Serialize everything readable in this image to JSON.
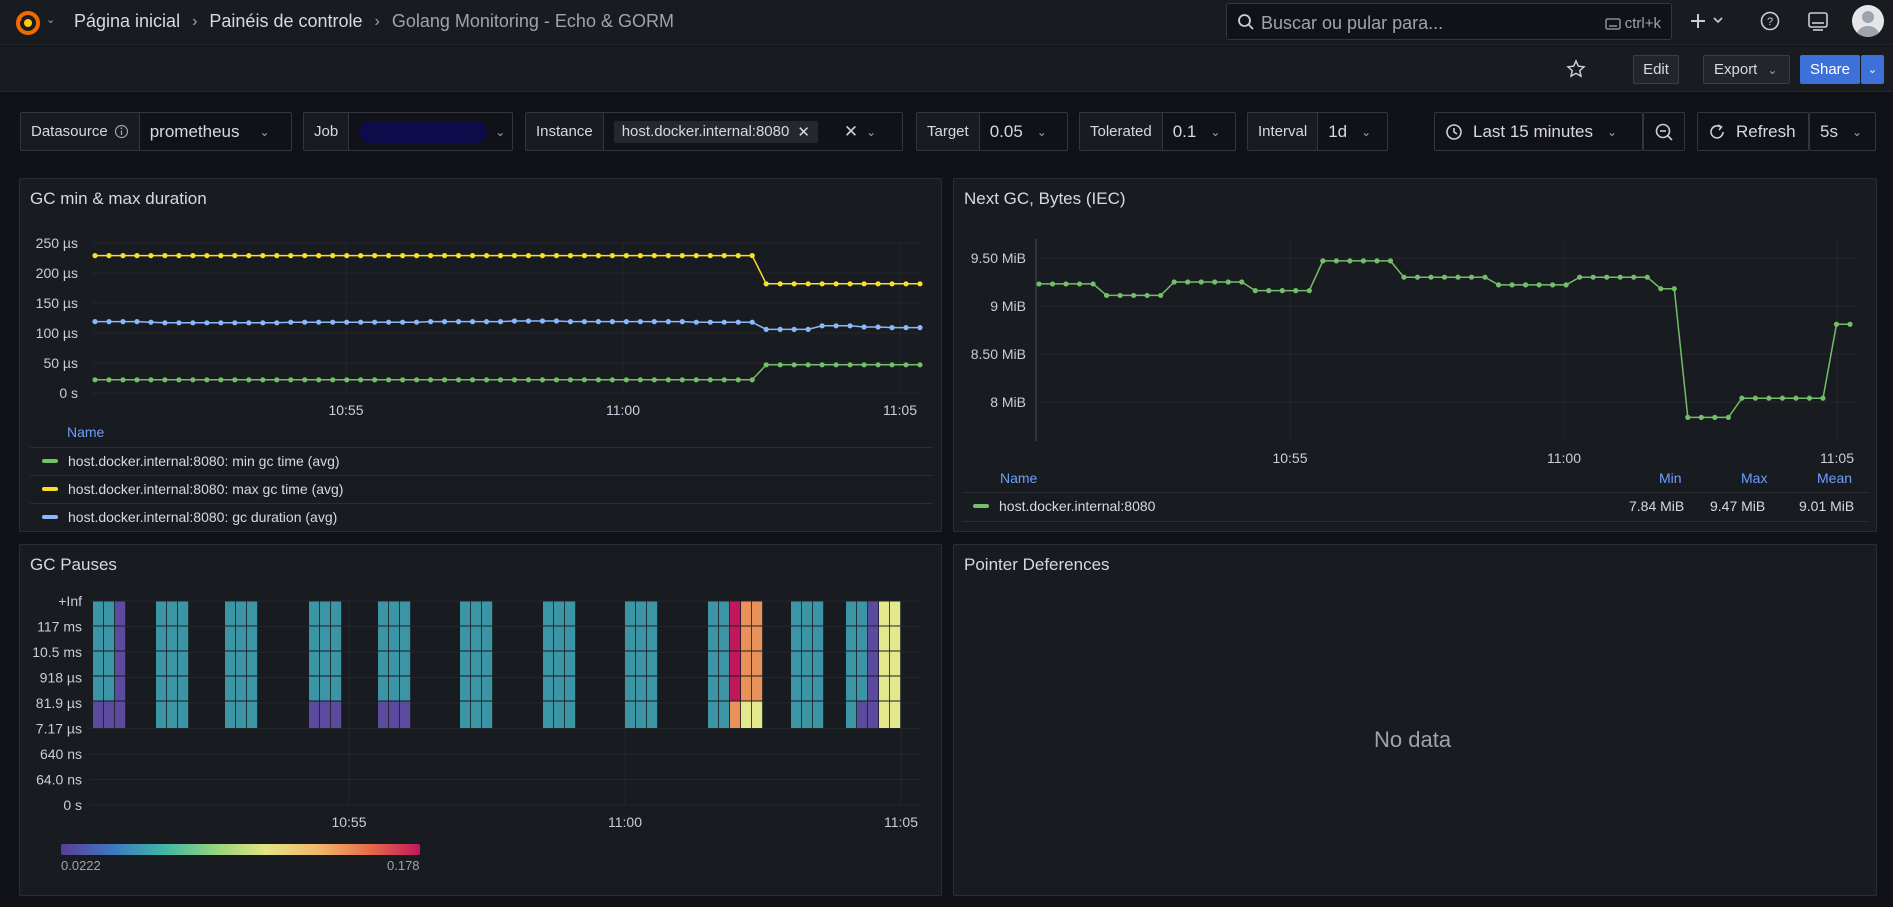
{
  "topbar": {
    "breadcrumbs": [
      "Página inicial",
      "Painéis de controle",
      "Golang Monitoring - Echo & GORM"
    ],
    "search_placeholder": "Buscar ou pular para...",
    "search_shortcut": "ctrl+k"
  },
  "actions": {
    "edit": "Edit",
    "export": "Export",
    "share": "Share"
  },
  "variables": [
    {
      "label": "Datasource",
      "value": "prometheus"
    },
    {
      "label": "Job",
      "value": ""
    },
    {
      "label": "Instance",
      "value": "host.docker.internal:8080"
    },
    {
      "label": "Target",
      "value": "0.05"
    },
    {
      "label": "Tolerated",
      "value": "0.1"
    },
    {
      "label": "Interval",
      "value": "1d"
    }
  ],
  "timepicker": {
    "range": "Last 15 minutes",
    "refresh_label": "Refresh",
    "refresh_interval": "5s"
  },
  "colors": {
    "green": "#73bf69",
    "yellow": "#fade2a",
    "blue": "#8ab8ff",
    "accent": "#3d71d9"
  },
  "panels": {
    "gc_duration": {
      "title": "GC min & max duration",
      "legend_header": "Name",
      "legend": [
        "host.docker.internal:8080: min gc time (avg)",
        "host.docker.internal:8080: max gc time (avg)",
        "host.docker.internal:8080: gc duration (avg)"
      ]
    },
    "next_gc": {
      "title": "Next GC, Bytes (IEC)",
      "legend_header": {
        "name": "Name",
        "min": "Min",
        "max": "Max",
        "mean": "Mean"
      },
      "legend": [
        {
          "name": "host.docker.internal:8080",
          "min": "7.84 MiB",
          "max": "9.47 MiB",
          "mean": "9.01 MiB"
        }
      ]
    },
    "gc_pauses": {
      "title": "GC Pauses",
      "scale_min": "0.0222",
      "scale_max": "0.178"
    },
    "pointer": {
      "title": "Pointer Deferences",
      "nodata": "No data"
    }
  },
  "chart_data": [
    {
      "type": "line",
      "title": "GC min & max duration",
      "ylabels": [
        "250 µs",
        "200 µs",
        "150 µs",
        "100 µs",
        "50 µs",
        "0 s"
      ],
      "ylim": [
        0,
        250
      ],
      "xlabels": [
        "10:55",
        "11:00",
        "11:05"
      ],
      "n": 60,
      "series": [
        {
          "name": "host.docker.internal:8080: min gc time (avg)",
          "color": "#73bf69",
          "segments": [
            [
              0,
              47,
              22
            ],
            [
              48,
              59,
              47
            ]
          ]
        },
        {
          "name": "host.docker.internal:8080: max gc time (avg)",
          "color": "#fade2a",
          "segments": [
            [
              0,
              47,
              229
            ],
            [
              48,
              59,
              182
            ]
          ]
        },
        {
          "name": "host.docker.internal:8080: gc duration (avg)",
          "color": "#8ab8ff",
          "values": [
            119,
            119,
            119,
            119,
            118,
            117,
            117,
            117,
            117,
            117,
            117,
            117,
            117,
            117,
            118,
            118,
            118,
            118,
            118,
            118,
            118,
            118,
            118,
            118,
            119,
            119,
            119,
            119,
            119,
            119,
            120,
            120,
            120,
            120,
            119,
            119,
            119,
            119,
            119,
            119,
            119,
            119,
            119,
            118,
            118,
            118,
            118,
            118,
            106,
            106,
            106,
            106,
            112,
            112,
            112,
            110,
            110,
            109,
            109,
            109
          ]
        }
      ]
    },
    {
      "type": "line",
      "title": "Next GC, Bytes (IEC)",
      "ylabels": [
        "9.50 MiB",
        "9 MiB",
        "8.50 MiB",
        "8 MiB"
      ],
      "ylim": [
        7.7,
        9.6
      ],
      "xlabels": [
        "10:55",
        "11:00",
        "11:05"
      ],
      "series": [
        {
          "name": "host.docker.internal:8080",
          "color": "#73bf69",
          "values": [
            9.23,
            9.23,
            9.23,
            9.23,
            9.23,
            9.11,
            9.11,
            9.11,
            9.11,
            9.11,
            9.25,
            9.25,
            9.25,
            9.25,
            9.25,
            9.25,
            9.16,
            9.16,
            9.16,
            9.16,
            9.16,
            9.47,
            9.47,
            9.47,
            9.47,
            9.47,
            9.47,
            9.3,
            9.3,
            9.3,
            9.3,
            9.3,
            9.3,
            9.3,
            9.22,
            9.22,
            9.22,
            9.22,
            9.22,
            9.22,
            9.3,
            9.3,
            9.3,
            9.3,
            9.3,
            9.3,
            9.18,
            9.18,
            7.84,
            7.84,
            7.84,
            7.84,
            8.04,
            8.04,
            8.04,
            8.04,
            8.04,
            8.04,
            8.04,
            8.81,
            8.81
          ]
        }
      ]
    },
    {
      "type": "heatmap",
      "title": "GC Pauses",
      "ylabels": [
        "+Inf",
        "117 ms",
        "10.5 ms",
        "918 µs",
        "81.9 µs",
        "7.17 µs",
        "640 ns",
        "64.0 ns",
        "0 s"
      ],
      "xlabels": [
        "10:55",
        "11:00",
        "11:05"
      ],
      "column_groups": [
        {
          "cols": [
            "t",
            "t",
            "p"
          ],
          "bottom": [
            "p",
            "p",
            "p"
          ]
        },
        {
          "cols": [
            "t",
            "t",
            "t"
          ],
          "bottom": [
            "t",
            "t",
            "t"
          ]
        },
        {
          "cols": [
            "t",
            "t",
            "t"
          ],
          "bottom": [
            "t",
            "t",
            "t"
          ]
        },
        {
          "cols": [
            "t",
            "t",
            "t"
          ],
          "bottom": [
            "p",
            "p",
            "p"
          ]
        },
        {
          "cols": [
            "t",
            "t",
            "t"
          ],
          "bottom": [
            "p",
            "p",
            "p"
          ]
        },
        {
          "cols": [
            "t",
            "t",
            "t"
          ],
          "bottom": [
            "t",
            "t",
            "t"
          ]
        },
        {
          "cols": [
            "t",
            "t",
            "t"
          ],
          "bottom": [
            "t",
            "t",
            "t"
          ]
        },
        {
          "cols": [
            "t",
            "t",
            "t"
          ],
          "bottom": [
            "t",
            "t",
            "t"
          ]
        },
        {
          "cols": [
            "t",
            "t",
            "r",
            "o",
            "o"
          ],
          "bottom": [
            "t",
            "t",
            "o",
            "y",
            "y"
          ]
        },
        {
          "cols": [
            "t",
            "t",
            "t"
          ],
          "bottom": [
            "t",
            "t",
            "t"
          ]
        },
        {
          "cols": [
            "t",
            "t",
            "p",
            "y",
            "y"
          ],
          "bottom": [
            "t",
            "p",
            "p",
            "y",
            "y"
          ]
        }
      ]
    }
  ]
}
